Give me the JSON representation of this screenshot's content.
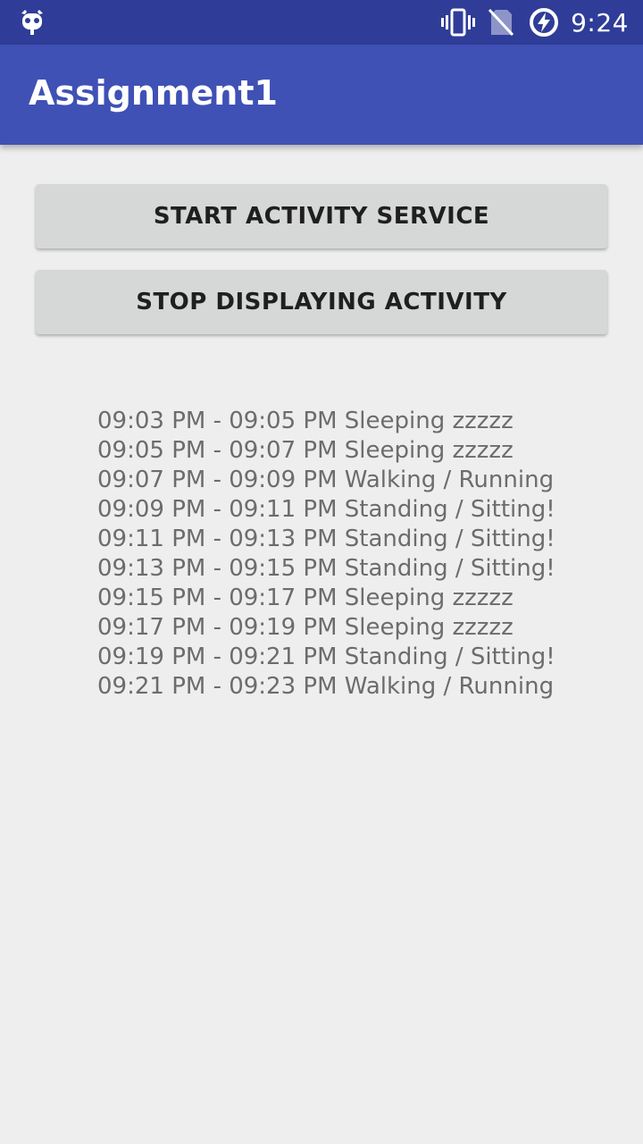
{
  "status_bar": {
    "time": "9:24",
    "icons": [
      "cyanogen-bugdroid-icon",
      "vibrate-icon",
      "no-sim-icon",
      "battery-charging-icon"
    ]
  },
  "app_bar": {
    "title": "Assignment1"
  },
  "buttons": {
    "start_label": "START ACTIVITY SERVICE",
    "stop_label": "STOP DISPLAYING ACTIVITY"
  },
  "activity_log": [
    "09:03 PM - 09:05 PM Sleeping zzzzz",
    "09:05 PM - 09:07 PM Sleeping zzzzz",
    "09:07 PM - 09:09 PM Walking / Running",
    "09:09 PM - 09:11 PM Standing / Sitting!",
    "09:11 PM - 09:13 PM Standing / Sitting!",
    "09:13 PM - 09:15 PM Standing / Sitting!",
    "09:15 PM - 09:17 PM Sleeping zzzzz",
    "09:17 PM - 09:19 PM Sleeping zzzzz",
    "09:19 PM - 09:21 PM Standing / Sitting!",
    "09:21 PM - 09:23 PM Walking / Running"
  ],
  "colors": {
    "status_bar": "#2f3d98",
    "app_bar": "#3f51b5",
    "background": "#eeeeee",
    "button": "#d6d7d7",
    "log_text": "#6c6c6c"
  }
}
